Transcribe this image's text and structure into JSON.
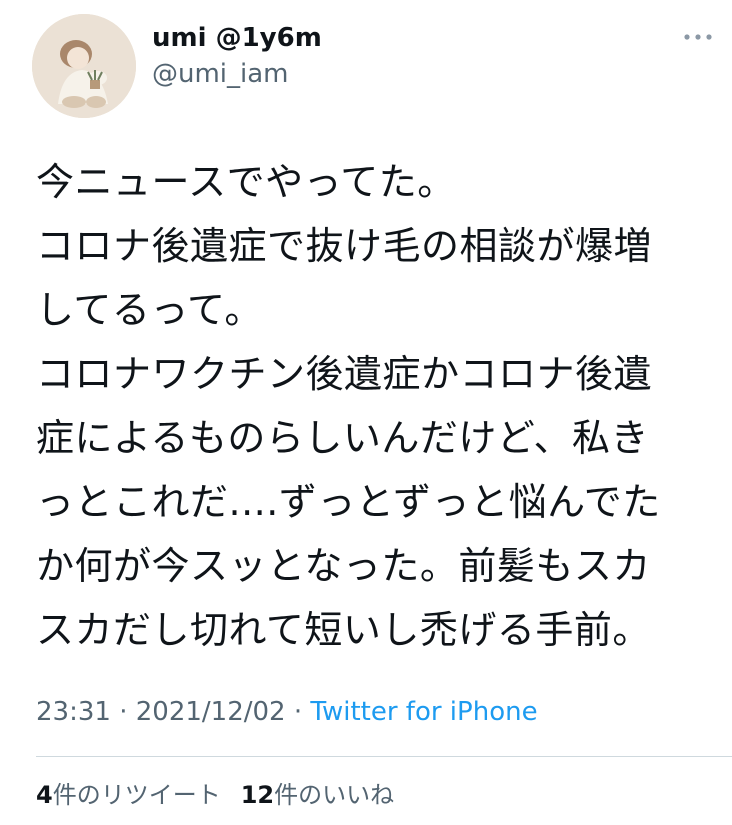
{
  "user": {
    "display_name": "umi @1y6m",
    "handle": "@umi_iam"
  },
  "tweet": {
    "lines": [
      "今ニュースでやってた。",
      "コロナ後遺症で抜け毛の相談が爆増",
      "してるって。",
      "コロナワクチン後遺症かコロナ後遺",
      "症によるものらしいんだけど、私き",
      "っとこれだ....ずっとずっと悩んでた",
      "か何が今スッとなった。前髪もスカ",
      "スカだし切れて短いし禿げる手前。"
    ]
  },
  "meta": {
    "time": "23:31",
    "sep1": " · ",
    "date": "2021/12/02",
    "sep2": " · ",
    "source": "Twitter for iPhone"
  },
  "stats": {
    "retweet_count": "4",
    "retweet_label": "件のリツイート",
    "like_count": "12",
    "like_label": "件のいいね"
  },
  "icons": {
    "more": "more-dots-icon",
    "avatar": "avatar-image"
  },
  "colors": {
    "text": "#0f1419",
    "secondary": "#536471",
    "link": "#1d9bf0",
    "divider": "#cfd9de"
  }
}
